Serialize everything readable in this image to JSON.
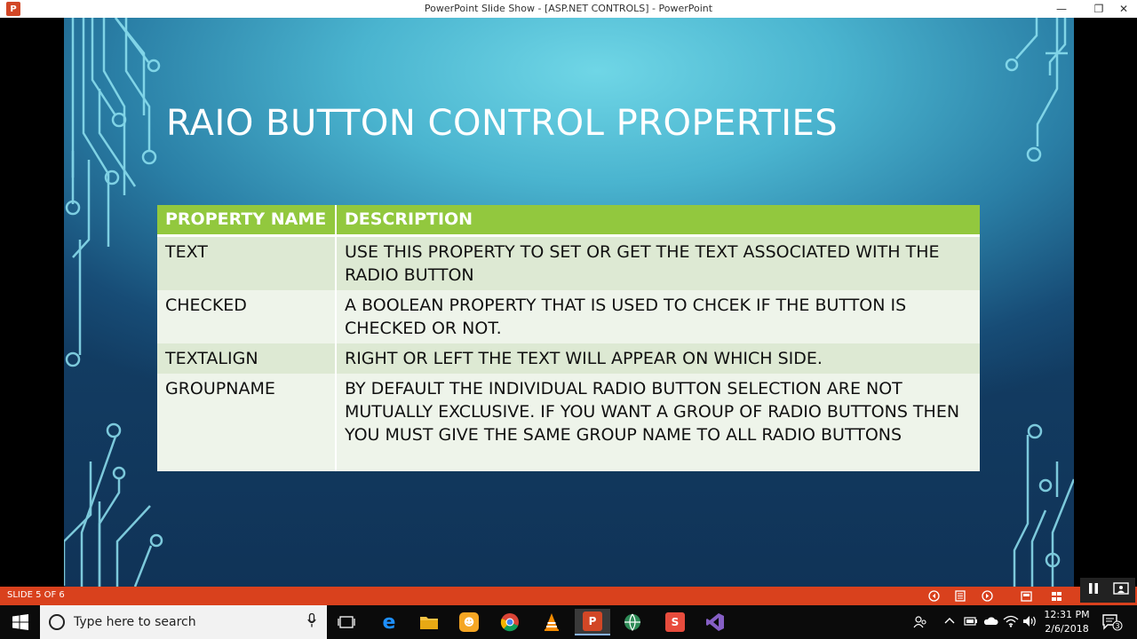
{
  "window": {
    "title": "PowerPoint Slide Show - [ASP.NET CONTROLS] - PowerPoint",
    "app_icon_letter": "P",
    "minimize_glyph": "—",
    "restore_glyph": "❐",
    "close_glyph": "✕"
  },
  "slide": {
    "title": "RAIO BUTTON CONTROL PROPERTIES",
    "table": {
      "headers": [
        "PROPERTY NAME",
        "DESCRIPTION"
      ],
      "rows": [
        {
          "name": "TEXT",
          "description": "USE THIS PROPERTY TO SET OR GET THE TEXT ASSOCIATED WITH THE RADIO BUTTON"
        },
        {
          "name": "CHECKED",
          "description": "A BOOLEAN PROPERTY THAT IS USED TO CHCEK IF THE BUTTON IS CHECKED OR NOT."
        },
        {
          "name": "TEXTALIGN",
          "description": "RIGHT OR LEFT THE TEXT WILL APPEAR ON WHICH SIDE."
        },
        {
          "name": "GROUPNAME",
          "description": "BY DEFAULT THE INDIVIDUAL RADIO BUTTON SELECTION ARE NOT MUTUALLY EXCLUSIVE. IF YOU WANT A GROUP OF RADIO BUTTONS THEN YOU MUST GIVE THE SAME GROUP NAME TO ALL RADIO BUTTONS"
        }
      ]
    }
  },
  "slideshow_bar": {
    "slide_counter": "SLIDE 5 OF 6"
  },
  "taskbar": {
    "search_placeholder": "Type here to search",
    "clock_time": "12:31 PM",
    "clock_date": "2/6/2018",
    "notification_count": "3"
  },
  "colors": {
    "header_green": "#92c83e",
    "show_bar": "#d9411d",
    "powerpoint_red": "#d24726"
  }
}
